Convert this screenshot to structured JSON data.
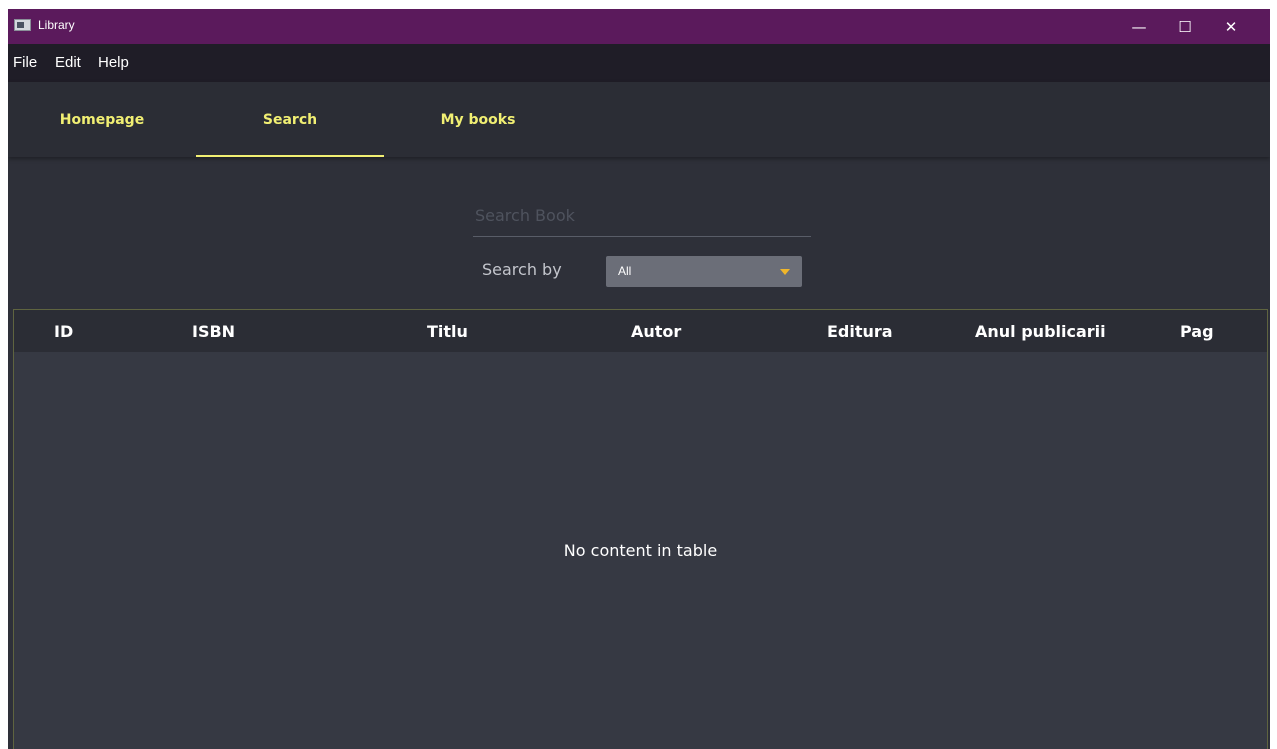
{
  "window": {
    "title": "Library",
    "controls": {
      "minimize": "—",
      "maximize": "☐",
      "close": "✕"
    }
  },
  "menu": {
    "items": [
      "File",
      "Edit",
      "Help"
    ]
  },
  "tabs": [
    {
      "label": "Homepage",
      "active": false
    },
    {
      "label": "Search",
      "active": true
    },
    {
      "label": "My books",
      "active": false
    }
  ],
  "search": {
    "placeholder": "Search Book",
    "value": "",
    "search_by_label": "Search by",
    "search_by_value": "All"
  },
  "table": {
    "columns": [
      "ID",
      "ISBN",
      "Titlu",
      "Autor",
      "Editura",
      "Anul publicarii",
      "Pag"
    ],
    "rows": [],
    "empty_message": "No content in table"
  },
  "colors": {
    "titlebar": "#5b1a5c",
    "menubar": "#1f1d27",
    "background": "#2e3039",
    "tab_text": "#f1ef73",
    "dropdown_arrow": "#f0b62a"
  },
  "icons": {
    "app": "app-icon",
    "minimize": "minimize-icon",
    "maximize": "maximize-icon",
    "close": "close-icon",
    "dropdown": "chevron-down-icon"
  }
}
